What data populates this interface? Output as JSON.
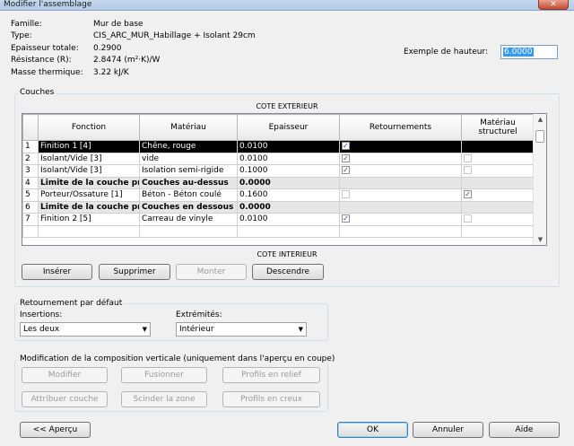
{
  "window": {
    "title": "Modifier l'assemblage",
    "close_glyph": "✕"
  },
  "properties": [
    {
      "label": "Famille:",
      "value": "Mur de base"
    },
    {
      "label": "Type:",
      "value": "CIS_ARC_MUR_Habillage + Isolant 29cm"
    },
    {
      "label": "Epaisseur totale:",
      "value": "0.2900"
    },
    {
      "label": "Résistance (R):",
      "value": "2.8474 (m²·K)/W"
    },
    {
      "label": "Masse thermique:",
      "value": "3.22 kJ/K"
    }
  ],
  "sample_height": {
    "label": "Exemple de hauteur:",
    "value": "6.0000"
  },
  "layers": {
    "group_label": "Couches",
    "exterior_label": "COTE EXTERIEUR",
    "interior_label": "COTE INTERIEUR",
    "columns": [
      "",
      "Fonction",
      "Matériau",
      "Epaisseur",
      "Retournements",
      "Matériau structurel"
    ],
    "rows": [
      {
        "num": "1",
        "fonction": "Finition 1 [4]",
        "materiau": "Chêne, rouge",
        "epaisseur": "0.0100",
        "wrap": "checked",
        "struct": "black",
        "style": "sel"
      },
      {
        "num": "2",
        "fonction": "Isolant/Vide [3]",
        "materiau": "vide",
        "epaisseur": "0.0100",
        "wrap": "checked",
        "struct": "empty",
        "style": ""
      },
      {
        "num": "3",
        "fonction": "Isolant/Vide [3]",
        "materiau": "Isolation semi-rigide",
        "epaisseur": "0.1000",
        "wrap": "checked",
        "struct": "empty",
        "style": ""
      },
      {
        "num": "4",
        "fonction": "Limite de la couche pri",
        "materiau": "Couches au-dessus",
        "epaisseur": "0.0000",
        "wrap": "none",
        "struct": "none",
        "style": "bold"
      },
      {
        "num": "5",
        "fonction": "Porteur/Ossature [1]",
        "materiau": "Béton - Béton coulé",
        "epaisseur": "0.1600",
        "wrap": "empty",
        "struct": "checked",
        "style": ""
      },
      {
        "num": "6",
        "fonction": "Limite de la couche pri",
        "materiau": "Couches en dessous",
        "epaisseur": "0.0000",
        "wrap": "none",
        "struct": "none",
        "style": "bold"
      },
      {
        "num": "7",
        "fonction": "Finition 2 [5]",
        "materiau": "Carreau de vinyle",
        "epaisseur": "0.0100",
        "wrap": "checked",
        "struct": "empty",
        "style": ""
      }
    ],
    "buttons": {
      "insert": "Insérer",
      "delete": "Supprimer",
      "up": "Monter",
      "down": "Descendre"
    }
  },
  "default_wrapping": {
    "group_label": "Retournement par défaut",
    "insertions_label": "Insertions:",
    "insertions_value": "Les deux",
    "ends_label": "Extrémités:",
    "ends_value": "Intérieur"
  },
  "vertical_modify": {
    "group_label": "Modification de la composition verticale (uniquement dans l'aperçu en coupe)",
    "buttons": [
      "Modifier",
      "Fusionner",
      "Profils en relief",
      "Attribuer couche",
      "Scinder la zone",
      "Profils en creux"
    ]
  },
  "footer": {
    "preview": "<< Aperçu",
    "ok": "OK",
    "cancel": "Annuler",
    "help": "Aide"
  },
  "icons": {
    "check": "✓",
    "arrow_down": "▼",
    "arrow_up": "▲"
  }
}
